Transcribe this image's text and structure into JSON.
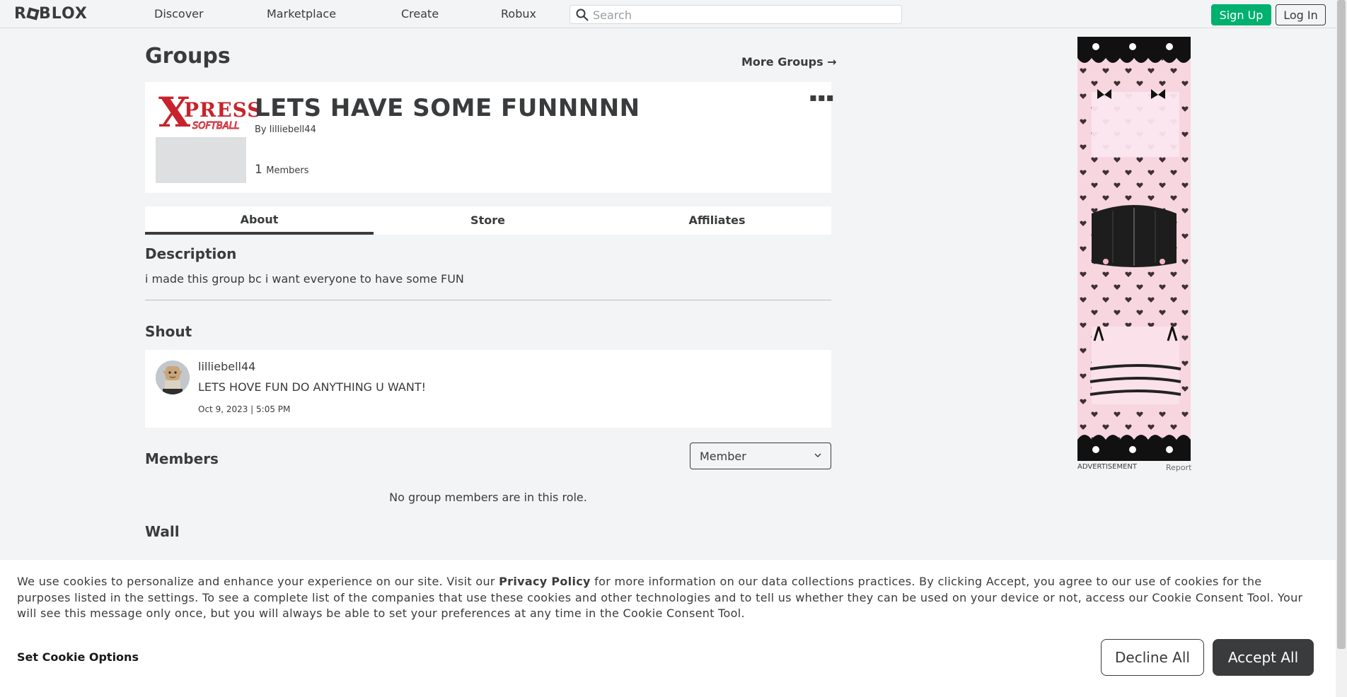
{
  "header": {
    "logo_text": "ROBLOX",
    "nav": [
      "Discover",
      "Marketplace",
      "Create",
      "Robux"
    ],
    "search_placeholder": "Search",
    "signup_label": "Sign Up",
    "login_label": "Log In"
  },
  "page": {
    "title": "Groups",
    "more_groups": "More Groups →"
  },
  "group": {
    "logo_letter": "X",
    "logo_press": "PRESS",
    "logo_softball": "SOFTBALL",
    "name": "LETS HAVE SOME FUNNNNN",
    "owner_prefix": "By",
    "owner": "lilliebell44",
    "member_count": "1",
    "member_label": "Members",
    "menu_glyph": "▪▪▪"
  },
  "tabs": [
    "About",
    "Store",
    "Affiliates"
  ],
  "description": {
    "title": "Description",
    "text": "i made this group bc i want everyone to have some FUN"
  },
  "shout": {
    "title": "Shout",
    "user": "lilliebell44",
    "text": "LETS HOVE FUN DO ANYTHING U WANT!",
    "date": "Oct 9, 2023 | 5:05 PM"
  },
  "members": {
    "title": "Members",
    "role": "Member",
    "empty_text": "No group members are in this role."
  },
  "wall": {
    "title": "Wall"
  },
  "ad": {
    "label": "ADVERTISEMENT",
    "report": "Report"
  },
  "cookie": {
    "text_before": "We use cookies to personalize and enhance your experience on our site. Visit our ",
    "privacy_link": "Privacy Policy",
    "text_after": " for more information on our data collections practices. By clicking Accept, you agree to our use of cookies for the purposes listed in the settings. To see a complete list of the companies that use these cookies and other technologies and to tell us whether they can be used on your device or not, access our Cookie Consent Tool. Your will see this message only once, but you will always be able to set your preferences at any time in the Cookie Consent Tool.",
    "options_label": "Set Cookie Options",
    "decline_label": "Decline All",
    "accept_label": "Accept All"
  },
  "colors": {
    "signup_green": "#00b06f",
    "logo_red": "#c8232c",
    "ad_pink": "#f7d6e0",
    "text_dark": "#393b3d"
  }
}
